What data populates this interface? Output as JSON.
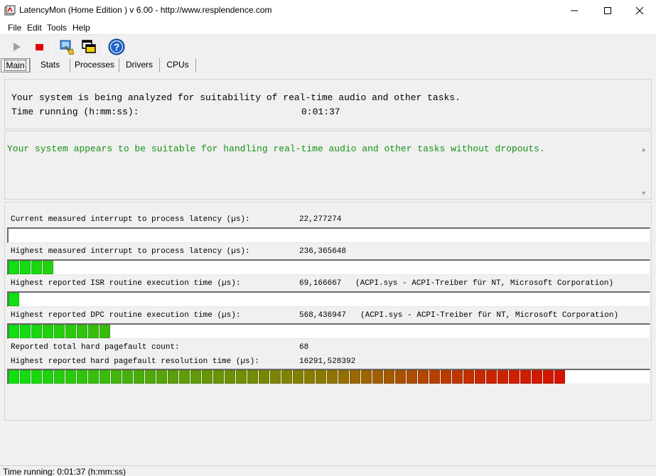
{
  "window": {
    "title": "LatencyMon  (Home Edition )  v 6.00 - http://www.resplendence.com"
  },
  "menu": [
    "File",
    "Edit",
    "Tools",
    "Help"
  ],
  "tabs": [
    "Main",
    "Stats",
    "Processes",
    "Drivers",
    "CPUs"
  ],
  "summary": {
    "analyzing": "Your system is being analyzed for suitability of real-time audio and other tasks.",
    "time_label": "Time running (h:mm:ss):",
    "time_value": "0:01:37"
  },
  "verdict": {
    "text": "Your system appears to be suitable for handling real-time audio and other tasks without dropouts.",
    "color": "#159215"
  },
  "metrics": [
    {
      "label": "Current measured interrupt to process latency (µs):",
      "value": "22,277274",
      "detail": "",
      "segments": 0
    },
    {
      "label": "Highest measured interrupt to process latency (µs):",
      "value": "236,365648",
      "detail": "",
      "segments": 4
    },
    {
      "label": "Highest reported ISR routine execution time (µs):",
      "value": "69,166667",
      "detail": "(ACPI.sys - ACPI-Treiber für NT, Microsoft Corporation)",
      "segments": 1
    },
    {
      "label": "Highest reported DPC routine execution time (µs):",
      "value": "568,436947",
      "detail": "(ACPI.sys - ACPI-Treiber für NT, Microsoft Corporation)",
      "segments": 9
    },
    {
      "label": "Reported total hard pagefault count:",
      "value": "68",
      "detail": ""
    },
    {
      "label": "Highest reported hard pagefault resolution time (µs):",
      "value": "16291,528392",
      "detail": "",
      "segments": 49
    }
  ],
  "status": {
    "text": "Time running: 0:01:37  (h:mm:ss)"
  }
}
